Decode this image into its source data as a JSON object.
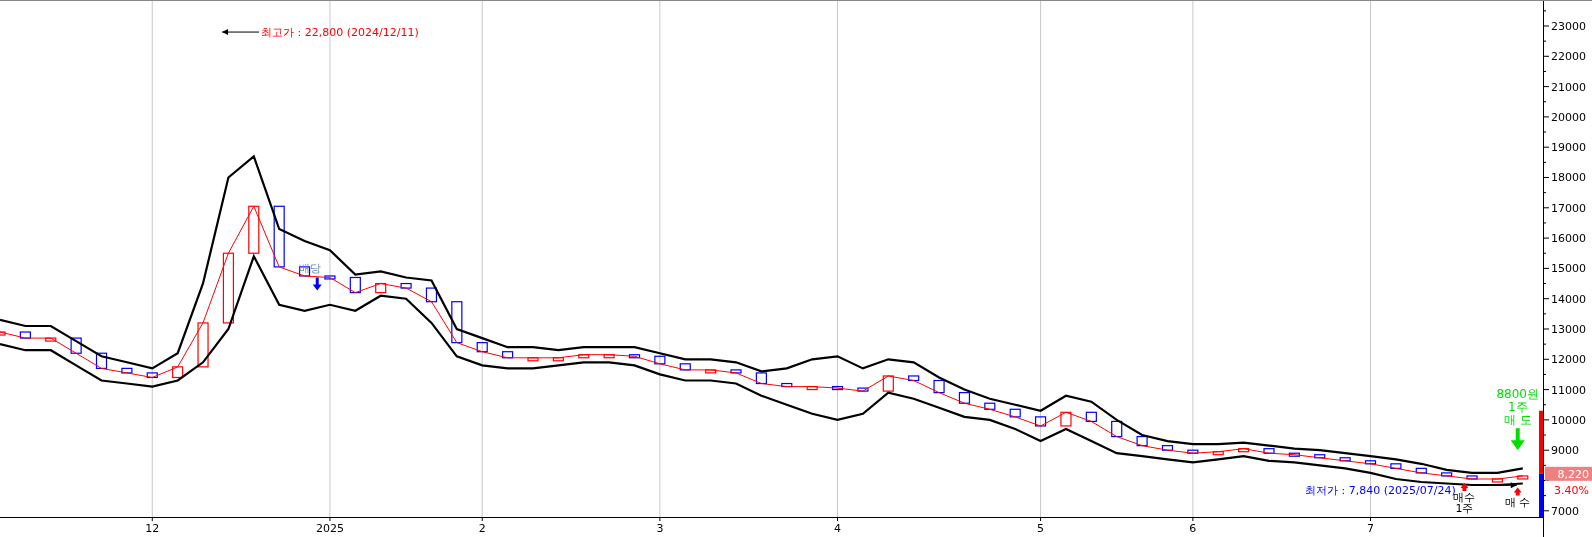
{
  "chart_data": {
    "type": "line",
    "grid": true,
    "ylim": [
      6795,
      23858
    ],
    "categories": [
      null,
      null,
      null,
      null,
      null,
      null,
      "12",
      null,
      null,
      null,
      null,
      null,
      null,
      "2025",
      null,
      null,
      null,
      null,
      null,
      "2",
      null,
      null,
      null,
      null,
      null,
      null,
      "3",
      null,
      null,
      null,
      null,
      null,
      null,
      "4",
      null,
      null,
      null,
      null,
      null,
      null,
      null,
      "5",
      null,
      null,
      null,
      null,
      null,
      "6",
      null,
      null,
      null,
      null,
      null,
      null,
      "7",
      null,
      null,
      null,
      null,
      null,
      null
    ],
    "yticks": [
      7000,
      9000,
      10000,
      11000,
      12000,
      13000,
      14000,
      15000,
      16000,
      17000,
      18000,
      19000,
      20000,
      21000,
      22000,
      23000
    ],
    "series": [
      {
        "color": "#ff0000",
        "values": [
          12900,
          12700,
          12700,
          12200,
          11700,
          11550,
          11400,
          11750,
          13200,
          15500,
          17050,
          15050,
          14750,
          14700,
          14200,
          14500,
          14350,
          13900,
          12550,
          12250,
          12050,
          12050,
          12050,
          12150,
          12150,
          12100,
          11850,
          11650,
          11650,
          11550,
          11200,
          11100,
          11100,
          11050,
          10950,
          11450,
          11300,
          10900,
          10550,
          10350,
          10100,
          9800,
          10250,
          9950,
          9450,
          9150,
          9000,
          8900,
          8950,
          9050,
          8900,
          8850,
          8750,
          8650,
          8550,
          8400,
          8250,
          8150,
          8050,
          8050,
          8150
        ]
      },
      {
        "color": "#000000",
        "values": [
          13300,
          13100,
          13100,
          12600,
          12100,
          11900,
          11700,
          12200,
          14500,
          18000,
          18700,
          16300,
          15900,
          15600,
          14800,
          14900,
          14700,
          14600,
          13000,
          12700,
          12400,
          12400,
          12300,
          12400,
          12400,
          12400,
          12200,
          12000,
          12000,
          11900,
          11600,
          11700,
          12000,
          12100,
          11700,
          12000,
          11900,
          11400,
          11000,
          10700,
          10500,
          10300,
          10800,
          10600,
          10000,
          9500,
          9300,
          9200,
          9200,
          9250,
          9150,
          9050,
          9000,
          8900,
          8800,
          8700,
          8550,
          8350,
          8250,
          8250,
          8400
        ]
      },
      {
        "color": "#000000",
        "values": [
          12500,
          12300,
          12300,
          11800,
          11300,
          11200,
          11100,
          11300,
          11900,
          13000,
          15400,
          13800,
          13600,
          13800,
          13600,
          14100,
          14000,
          13200,
          12100,
          11800,
          11700,
          11700,
          11800,
          11900,
          11900,
          11800,
          11500,
          11300,
          11300,
          11200,
          10800,
          10500,
          10200,
          10000,
          10200,
          10900,
          10700,
          10400,
          10100,
          10000,
          9700,
          9300,
          9700,
          9300,
          8900,
          8800,
          8700,
          8600,
          8700,
          8800,
          8650,
          8600,
          8500,
          8400,
          8250,
          8050,
          7950,
          7900,
          7850,
          7850,
          7900
        ]
      }
    ]
  },
  "markers": [
    {
      "kind": "high",
      "text": "최고가 : 22,800 (2024/12/11)",
      "color": "#ff0000"
    },
    {
      "kind": "mark",
      "text": "배당",
      "color": "#6a8ab0"
    },
    {
      "kind": "low",
      "text": "최저가 : 7,840 (2025/07/24)",
      "color": "#0000ff"
    },
    {
      "kind": "sell",
      "lines": [
        "8800원",
        "1주",
        "매 도"
      ],
      "color": "#00dd00"
    },
    {
      "kind": "buy",
      "lines": [
        "매수",
        "1주"
      ],
      "color": "#ff0000"
    },
    {
      "kind": "buy",
      "lines": [
        "매 수"
      ],
      "color": "#ff0000"
    }
  ],
  "price_tag": {
    "value": "8,220",
    "change": "3.40%"
  }
}
